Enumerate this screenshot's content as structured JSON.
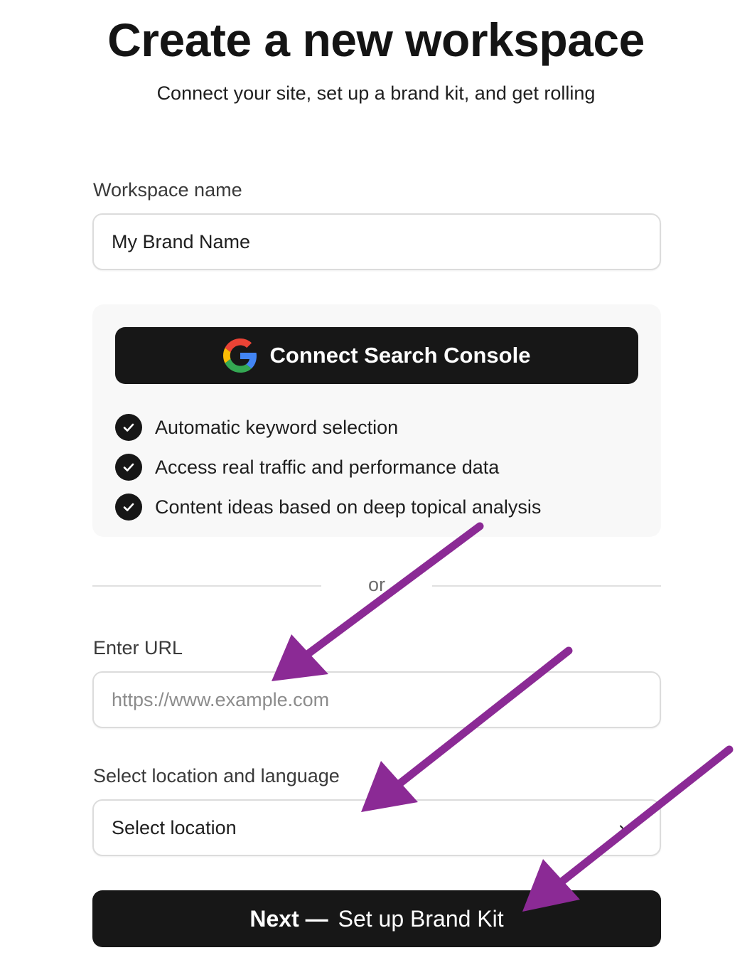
{
  "header": {
    "title": "Create a new workspace",
    "subtitle": "Connect your site, set up a brand kit, and get rolling"
  },
  "workspace": {
    "label": "Workspace name",
    "value": "My Brand Name"
  },
  "search_console": {
    "button_label": "Connect Search Console",
    "icon": "google-icon",
    "benefits": [
      "Automatic keyword selection",
      "Access real traffic and performance data",
      "Content ideas based on deep topical analysis"
    ]
  },
  "divider": {
    "text": "or"
  },
  "url": {
    "label": "Enter URL",
    "placeholder": "https://www.example.com"
  },
  "location": {
    "label": "Select location and language",
    "value": "Select location"
  },
  "next": {
    "strong": "Next —",
    "label": "Set up Brand Kit"
  },
  "colors": {
    "button_bg": "#171717",
    "annotation_arrow": "#8b2a95",
    "card_bg": "#f8f8f8"
  }
}
